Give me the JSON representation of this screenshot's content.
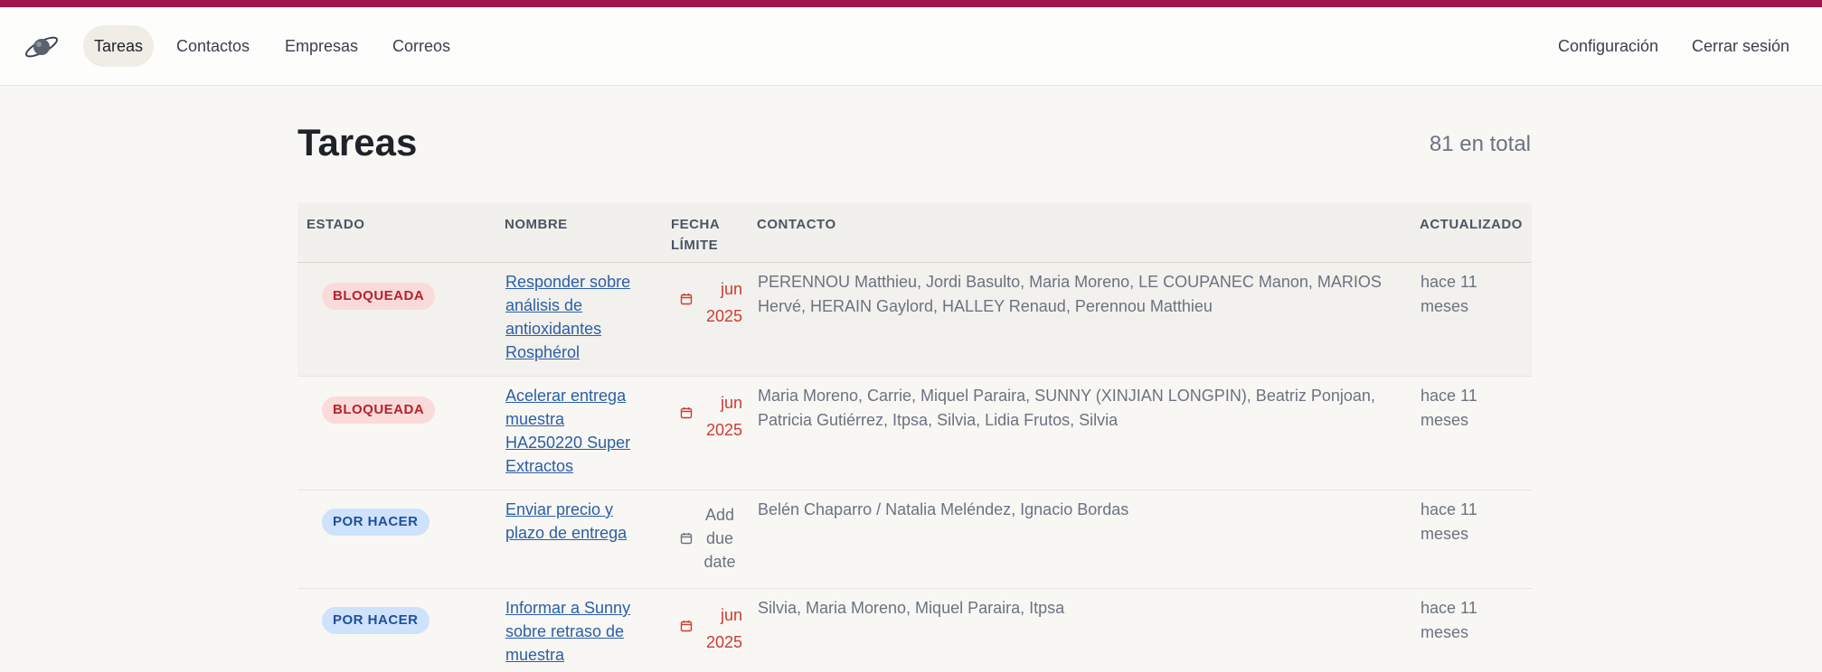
{
  "nav": {
    "items": [
      {
        "label": "Tareas",
        "active": true
      },
      {
        "label": "Contactos",
        "active": false
      },
      {
        "label": "Empresas",
        "active": false
      },
      {
        "label": "Correos",
        "active": false
      }
    ],
    "settings_label": "Configuración",
    "logout_label": "Cerrar sesión"
  },
  "page": {
    "title": "Tareas",
    "total": "81 en total"
  },
  "table": {
    "headers": {
      "estado": "ESTADO",
      "nombre": "NOMBRE",
      "fecha_1": "FECHA",
      "fecha_2": "LÍMITE",
      "contacto": "CONTACTO",
      "actualizado": "ACTUALIZADO"
    },
    "rows": [
      {
        "status": "BLOQUEADA",
        "status_type": "blocked",
        "name": [
          "Responder sobre",
          "análisis de",
          "antioxidantes",
          "Rosphérol"
        ],
        "due": [
          "jun",
          "2025"
        ],
        "contact": "PERENNOU Matthieu, Jordi Basulto, Maria Moreno, LE COUPANEC Manon, MARIOS Hervé, HERAIN Gaylord, HALLEY Renaud, Perennou Matthieu",
        "updated": [
          "hace 11",
          "meses"
        ]
      },
      {
        "status": "BLOQUEADA",
        "status_type": "blocked",
        "name": [
          "Acelerar entrega",
          "muestra",
          "HA250220 Super",
          "Extractos"
        ],
        "due": [
          "jun",
          "2025"
        ],
        "contact": "Maria Moreno, Carrie, Miquel Paraira, SUNNY (XINJIAN LONGPIN), Beatriz Ponjoan, Patricia Gutiérrez, Itpsa, Silvia, Lidia Frutos, Silvia",
        "updated": [
          "hace 11",
          "meses"
        ]
      },
      {
        "status": "POR HACER",
        "status_type": "todo",
        "name": [
          "Enviar precio y",
          "plazo de entrega"
        ],
        "due_none": [
          "Add",
          "due",
          "date"
        ],
        "contact": "Belén Chaparro / Natalia Meléndez, Ignacio Bordas",
        "updated": [
          "hace 11",
          "meses"
        ]
      },
      {
        "status": "POR HACER",
        "status_type": "todo",
        "name": [
          "Informar a Sunny",
          "sobre retraso de",
          "muestra"
        ],
        "due": [
          "jun",
          "2025"
        ],
        "contact": "Silvia, Maria Moreno, Miquel Paraira, Itpsa",
        "updated": [
          "hace 11",
          "meses"
        ]
      }
    ]
  },
  "colors": {
    "brand": "#a3154e",
    "blocked_bg": "#fbdada",
    "blocked_text": "#b4232a",
    "todo_bg": "#cfe2fb",
    "todo_text": "#1d4f9c",
    "due_red": "#cf3a30",
    "link": "#2b5ea8"
  },
  "icons": {
    "logo": "planet-logo-icon",
    "calendar": "calendar-icon"
  }
}
